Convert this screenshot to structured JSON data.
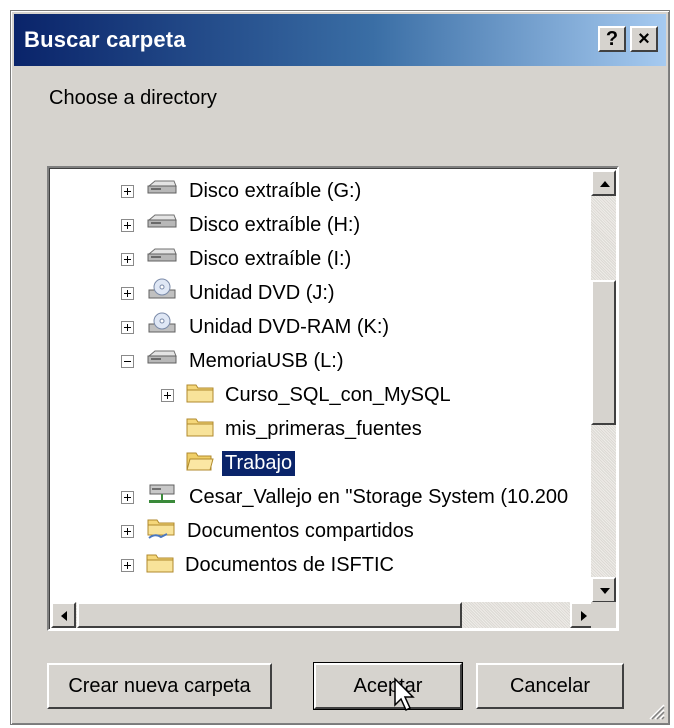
{
  "dialog": {
    "title": "Buscar carpeta",
    "help_label": "?",
    "close_label": "×",
    "instruction": "Choose a directory"
  },
  "tree": {
    "items": [
      {
        "label": "Disco extraíble (G:)",
        "icon": "removable-drive-icon",
        "expander": "plus",
        "level": 0
      },
      {
        "label": "Disco extraíble (H:)",
        "icon": "removable-drive-icon",
        "expander": "plus",
        "level": 0
      },
      {
        "label": "Disco extraíble (I:)",
        "icon": "removable-drive-icon",
        "expander": "plus",
        "level": 0
      },
      {
        "label": "Unidad DVD (J:)",
        "icon": "dvd-drive-icon",
        "expander": "plus",
        "level": 0
      },
      {
        "label": "Unidad DVD-RAM (K:)",
        "icon": "dvd-drive-icon",
        "expander": "plus",
        "level": 0
      },
      {
        "label": "MemoriaUSB (L:)",
        "icon": "removable-drive-icon",
        "expander": "minus",
        "level": 0
      },
      {
        "label": "Curso_SQL_con_MySQL",
        "icon": "folder-icon",
        "expander": "plus",
        "level": 1
      },
      {
        "label": "mis_primeras_fuentes",
        "icon": "folder-icon",
        "expander": "none",
        "level": 1
      },
      {
        "label": "Trabajo",
        "icon": "folder-open-icon",
        "expander": "none",
        "level": 1,
        "selected": true
      },
      {
        "label": "Cesar_Vallejo en \"Storage System (10.200",
        "icon": "network-drive-icon",
        "expander": "plus",
        "level": 0
      },
      {
        "label": "Documentos compartidos",
        "icon": "shared-folder-icon",
        "expander": "plus",
        "level": 0
      },
      {
        "label": "Documentos de ISFTIC",
        "icon": "folder-icon",
        "expander": "plus",
        "level": 0
      }
    ]
  },
  "buttons": {
    "new_folder": "Crear nueva carpeta",
    "ok": "Aceptar",
    "cancel": "Cancelar"
  },
  "colors": {
    "title_gradient_start": "#0a246a",
    "title_gradient_end": "#a6caf0",
    "selection": "#0a246a",
    "dialog_face": "#d6d3ce"
  }
}
